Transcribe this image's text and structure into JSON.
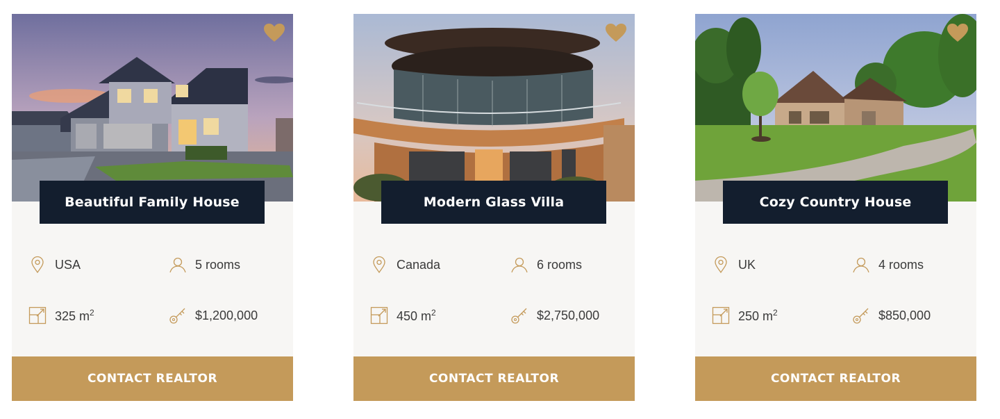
{
  "accent_color": "#c49a5a",
  "title_bg_color": "#131e2e",
  "cards": [
    {
      "title": "Beautiful Family House",
      "location": "USA",
      "rooms": "5 rooms",
      "area_value": "325 m",
      "area_unit_exp": "2",
      "price": "$1,200,000",
      "cta_label": "CONTACT REALTOR",
      "favorite_icon": "heart-icon"
    },
    {
      "title": "Modern Glass Villa",
      "location": "Canada",
      "rooms": "6 rooms",
      "area_value": "450 m",
      "area_unit_exp": "2",
      "price": "$2,750,000",
      "cta_label": "CONTACT REALTOR",
      "favorite_icon": "heart-icon"
    },
    {
      "title": "Cozy Country House",
      "location": "UK",
      "rooms": "4 rooms",
      "area_value": "250 m",
      "area_unit_exp": "2",
      "price": "$850,000",
      "cta_label": "CONTACT REALTOR",
      "favorite_icon": "heart-icon"
    }
  ]
}
